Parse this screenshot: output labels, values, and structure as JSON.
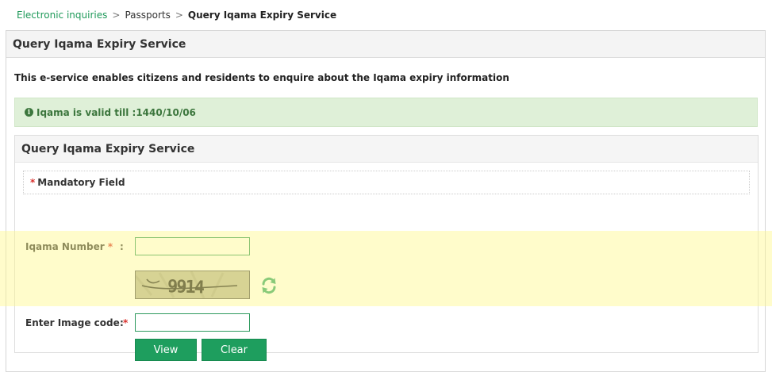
{
  "breadcrumb": {
    "items": [
      "Electronic inquiries",
      "Passports",
      "Query Iqama Expiry Service"
    ],
    "separator": ">"
  },
  "panel": {
    "title": "Query Iqama Expiry Service",
    "description": "This e-service enables citizens and residents to enquire about the Iqama expiry information"
  },
  "alert": {
    "icon": "info-circle-icon",
    "icon_glyph": "i",
    "text": "Iqama is valid till :1440/10/06"
  },
  "form": {
    "title": "Query Iqama Expiry Service",
    "required_marker": "*",
    "mandatory_note": "Mandatory Field",
    "colon": ":",
    "iqama_label": "Iqama Number",
    "iqama_value": "",
    "image_code_label": "Enter Image code",
    "image_code_value": "",
    "captcha_text": "9914",
    "refresh_icon": "refresh-icon",
    "view_button": "View",
    "clear_button": "Clear"
  },
  "colors": {
    "accent": "#1e9e5e",
    "alert_bg": "#dff0d8",
    "alert_text": "#3c763d",
    "highlight": "#fff88c"
  }
}
